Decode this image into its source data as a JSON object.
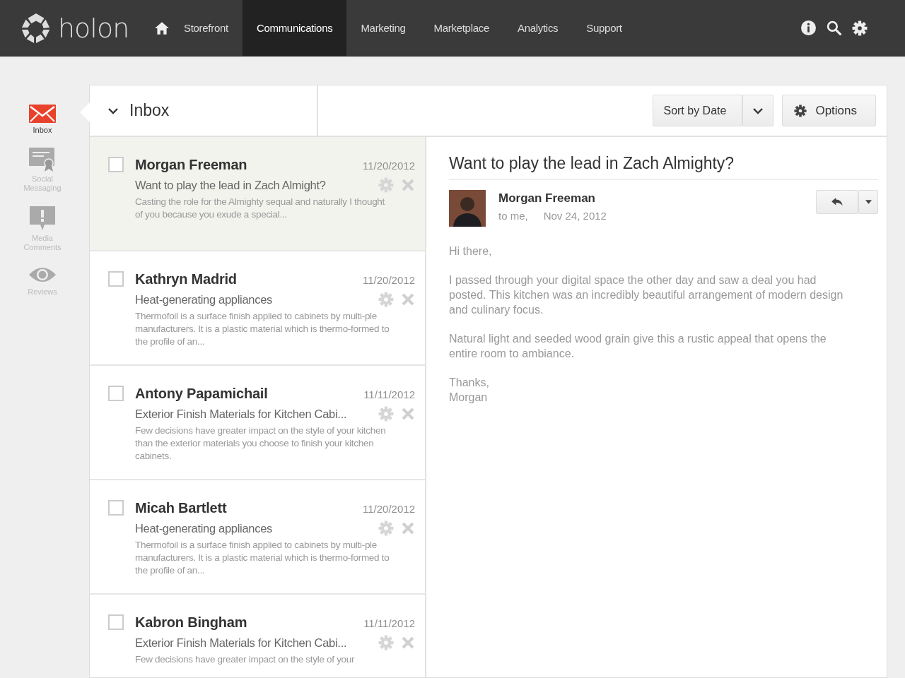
{
  "nav": {
    "logo": "holon",
    "items": [
      {
        "label": "Storefront",
        "selected": false
      },
      {
        "label": "Communications",
        "selected": true
      },
      {
        "label": "Marketing",
        "selected": false
      },
      {
        "label": "Marketplace",
        "selected": false
      },
      {
        "label": "Analytics",
        "selected": false
      },
      {
        "label": "Support",
        "selected": false
      }
    ]
  },
  "sidebar": {
    "items": [
      {
        "label": "Inbox",
        "kind": "mail",
        "selected": true
      },
      {
        "label": "Social Messaging",
        "kind": "certificate",
        "selected": false
      },
      {
        "label": "Media Comments",
        "kind": "comment",
        "selected": false
      },
      {
        "label": "Reviews",
        "kind": "eye",
        "selected": false
      }
    ]
  },
  "folder": {
    "title": "Inbox",
    "expanded": true
  },
  "toolbar": {
    "sort": "Sort by Date",
    "options": "Options"
  },
  "messages": [
    {
      "name": "Morgan Freeman",
      "date": "11/20/2012",
      "subject": "Want to play the lead in Zach Almight?",
      "preview": "Casting the role for the Almighty sequal and naturally I thought of you because you exude a special...",
      "selected": true,
      "checked": false
    },
    {
      "name": "Kathryn Madrid",
      "date": "11/20/2012",
      "subject": "Heat-generating appliances",
      "preview": "Thermofoil is a surface finish applied to cabinets by multi-ple manufacturers. It is a plastic material which is thermo-formed to the profile of an...",
      "selected": false,
      "checked": false
    },
    {
      "name": "Antony Papamichail",
      "date": "11/11/2012",
      "subject": "Exterior Finish Materials for Kitchen Cabi...",
      "preview": "Few decisions have greater impact on the style of your kitchen than the exterior materials you choose to finish your kitchen cabinets.",
      "selected": false,
      "checked": false
    },
    {
      "name": "Micah Bartlett",
      "date": "11/20/2012",
      "subject": "Heat-generating appliances",
      "preview": "Thermofoil is a surface finish applied to cabinets by multi-ple manufacturers. It is a plastic material which is thermo-formed to the profile of an...",
      "selected": false,
      "checked": false
    },
    {
      "name": "Kabron Bingham",
      "date": "11/11/2012",
      "subject": "Exterior Finish Materials for Kitchen Cabi...",
      "preview": "Few decisions have greater impact on the style of your",
      "selected": false,
      "checked": false
    }
  ],
  "reader": {
    "subject": "Want to play the lead in Zach Almighty?",
    "sender": "Morgan Freeman",
    "to": "to me,",
    "date": "Nov 24, 2012",
    "body": [
      "Hi there,",
      "I passed through your digital space the other day and saw a deal you had posted. This kitchen was an incredibly beautiful arrangement of modern design and culinary focus.",
      "Natural light and seeded wood grain give this a rustic appeal that opens the entire room to ambiance.",
      "Thanks,\nMorgan"
    ]
  }
}
